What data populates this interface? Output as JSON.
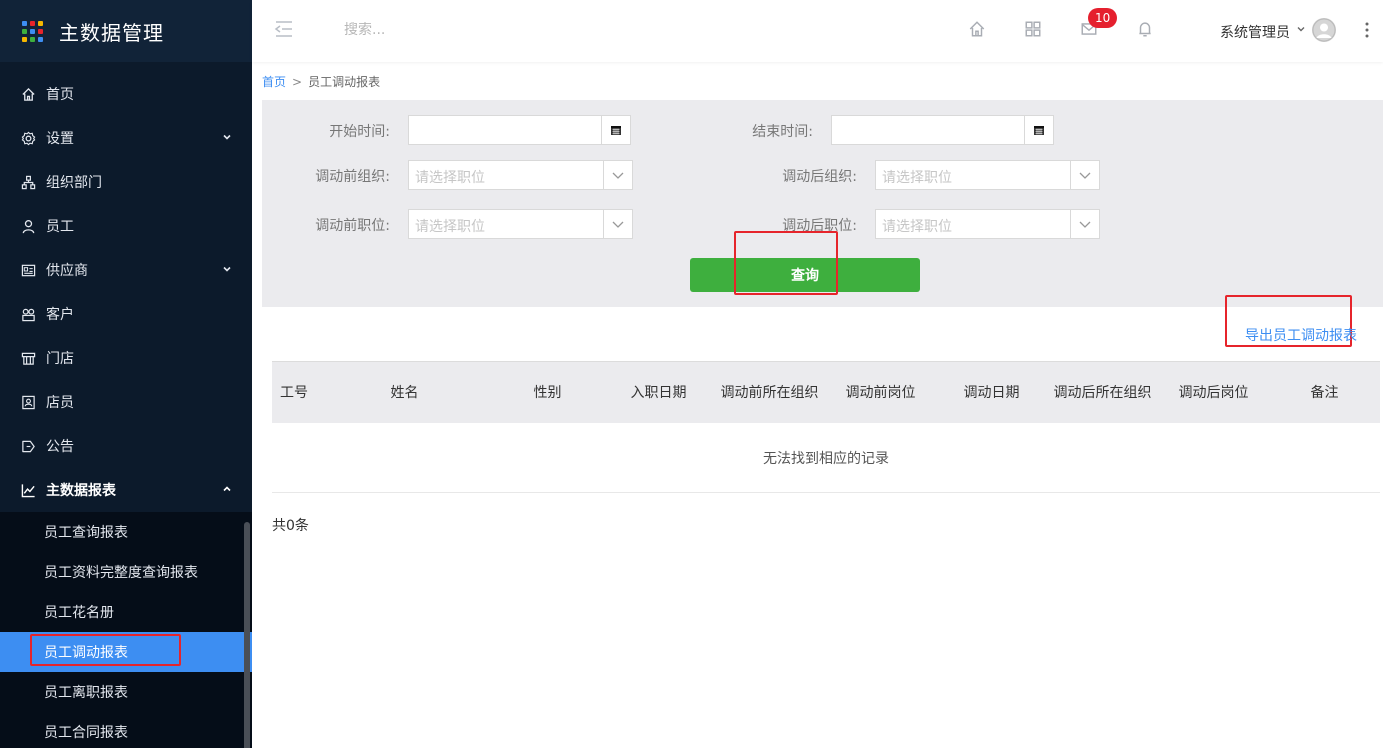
{
  "app": {
    "title": "主数据管理",
    "logo_icon": "grid-logo-icon"
  },
  "sidebar": {
    "items": [
      {
        "label": "首页",
        "icon": "home-icon"
      },
      {
        "label": "设置",
        "icon": "gear-icon",
        "expandable": true
      },
      {
        "label": "组织部门",
        "icon": "org-chart-icon"
      },
      {
        "label": "员工",
        "icon": "user-icon"
      },
      {
        "label": "供应商",
        "icon": "supplier-card-icon",
        "expandable": true
      },
      {
        "label": "客户",
        "icon": "customer-icon"
      },
      {
        "label": "门店",
        "icon": "store-icon"
      },
      {
        "label": "店员",
        "icon": "clerk-badge-icon"
      },
      {
        "label": "公告",
        "icon": "announcement-icon"
      },
      {
        "label": "主数据报表",
        "icon": "chart-line-icon",
        "expanded": true
      }
    ],
    "subitems": [
      {
        "label": "员工查询报表"
      },
      {
        "label": "员工资料完整度查询报表"
      },
      {
        "label": "员工花名册"
      },
      {
        "label": "员工调动报表",
        "active": true
      },
      {
        "label": "员工离职报表"
      },
      {
        "label": "员工合同报表"
      }
    ]
  },
  "topbar": {
    "search_placeholder": "搜索...",
    "badge_count": "10",
    "user_name": "系统管理员"
  },
  "breadcrumb": {
    "home": "首页",
    "separator": ">",
    "current": "员工调动报表"
  },
  "filters": {
    "start_time_label": "开始时间:",
    "end_time_label": "结束时间:",
    "org_before_label": "调动前组织:",
    "org_after_label": "调动后组织:",
    "pos_before_label": "调动前职位:",
    "pos_after_label": "调动后职位:",
    "select_placeholder": "请选择职位",
    "query_button": "查询"
  },
  "export_link": "导出员工调动报表",
  "table": {
    "columns": [
      "工号",
      "姓名",
      "性别",
      "入职日期",
      "调动前所在组织",
      "调动前岗位",
      "调动日期",
      "调动后所在组织",
      "调动后岗位",
      "备注"
    ],
    "empty_message": "无法找到相应的记录",
    "total": "共0条"
  },
  "colors": {
    "sidebar_bg": "#0c1a2b",
    "active_item": "#3d8ef2",
    "query_button": "#3eaf3e",
    "highlight_border": "#e6242b",
    "badge": "#e5202e"
  }
}
